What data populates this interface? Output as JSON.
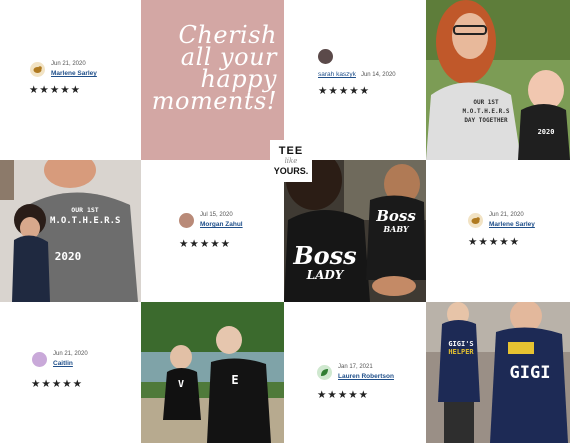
{
  "quote_card": {
    "text": "Cherish all your happy moments!"
  },
  "logo": {
    "line1": "TEE",
    "line2": "like",
    "line3": "YOURS."
  },
  "reviews": [
    {
      "date": "Jun 21, 2020",
      "name": "Marlene Sarley",
      "stars": "★★★★★",
      "avatar_color": "#f2e3c4"
    },
    {
      "date": "Jun 14, 2020",
      "name": "sarah kaszyk",
      "stars": "★★★★★",
      "avatar_color": "#5b4a4a"
    },
    {
      "date": "Jul 15, 2020",
      "name": "Morgan Zahul",
      "stars": "★★★★★",
      "avatar_color": "#b98a78"
    },
    {
      "date": "Jun 21, 2020",
      "name": "Marlene Sarley",
      "stars": "★★★★★",
      "avatar_color": "#f2e3c4"
    },
    {
      "date": "Jun 21, 2020",
      "name": "Caitlin",
      "stars": "★★★★★",
      "avatar_color": "#c9a9d9"
    },
    {
      "date": "Jan 17, 2021",
      "name": "Lauren Robertson",
      "stars": "★★★★★",
      "avatar_color": "#cfe8cf"
    }
  ],
  "photos": [
    {
      "name": "mom-with-newborn-shirt",
      "shirt_text": [
        "OUR 1ST",
        "M.O.T.H.E.R.S",
        "DAY TOGETHER",
        "2020"
      ]
    },
    {
      "name": "mom-holding-baby-gray-shirt",
      "shirt_text": [
        "OUR 1ST",
        "M.O.T.H.E.R.S",
        "2020"
      ]
    },
    {
      "name": "boss-lady-boss-baby",
      "shirt_text": [
        "Boss",
        "LADY",
        "Boss",
        "BABY"
      ]
    },
    {
      "name": "matching-shirts-outdoor",
      "shirt_text": [
        "V",
        "E"
      ]
    },
    {
      "name": "gigi-helper-shirts",
      "shirt_text": [
        "GIGI'S",
        "HELPER",
        "GIGI"
      ]
    }
  ]
}
